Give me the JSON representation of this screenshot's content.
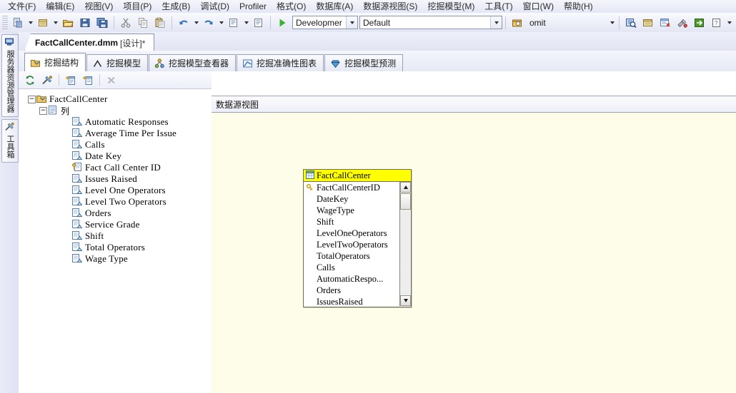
{
  "menu": {
    "items": [
      {
        "label": "文件(F)"
      },
      {
        "label": "编辑(E)"
      },
      {
        "label": "视图(V)"
      },
      {
        "label": "项目(P)"
      },
      {
        "label": "生成(B)"
      },
      {
        "label": "调试(D)"
      },
      {
        "label": "Profiler"
      },
      {
        "label": "格式(O)"
      },
      {
        "label": "数据库(A)"
      },
      {
        "label": "数据源视图(S)"
      },
      {
        "label": "挖掘模型(M)"
      },
      {
        "label": "工具(T)"
      },
      {
        "label": "窗口(W)"
      },
      {
        "label": "帮助(H)"
      }
    ]
  },
  "toolbar": {
    "icons": [
      {
        "name": "new-project-icon"
      },
      {
        "name": "new-item-icon"
      },
      {
        "name": "open-folder-icon"
      },
      {
        "name": "save-icon"
      },
      {
        "name": "save-all-icon"
      },
      {
        "name": "cut-icon"
      },
      {
        "name": "copy-icon"
      },
      {
        "name": "paste-icon"
      },
      {
        "name": "undo-icon"
      },
      {
        "name": "redo-icon"
      },
      {
        "name": "comment-icon"
      },
      {
        "name": "uncomment-icon"
      },
      {
        "name": "start-debug-icon"
      }
    ],
    "configuration": {
      "value": "Developmer",
      "placeholder": "Developmer"
    },
    "platform": {
      "value": "Default",
      "placeholder": "Default"
    },
    "deploy_label": "omit",
    "right_icons": [
      {
        "name": "find-in-files-icon"
      },
      {
        "name": "properties-window-icon"
      },
      {
        "name": "solution-explorer-icon"
      },
      {
        "name": "tools-options-icon"
      },
      {
        "name": "deploy-icon"
      },
      {
        "name": "new-query-icon"
      }
    ]
  },
  "vdock": {
    "tabs": [
      {
        "label": "服务器资源管理器",
        "icon": "server-explorer-icon"
      },
      {
        "label": "工具箱",
        "icon": "toolbox-icon"
      }
    ]
  },
  "doc_tab": {
    "name": "FactCallCenter.dmm",
    "state": "[设计]*"
  },
  "inner_tabs": [
    {
      "label": "挖掘结构",
      "icon": "mining-structure-icon",
      "active": true
    },
    {
      "label": "挖掘模型",
      "icon": "mining-model-icon",
      "active": false
    },
    {
      "label": "挖掘模型查看器",
      "icon": "mining-model-viewer-icon",
      "active": false
    },
    {
      "label": "挖掘准确性图表",
      "icon": "mining-accuracy-chart-icon",
      "active": false
    },
    {
      "label": "挖掘模型预测",
      "icon": "mining-model-prediction-icon",
      "active": false
    }
  ],
  "tree_toolbar": [
    {
      "name": "refresh-structure-icon"
    },
    {
      "name": "process-mining-structure-icon"
    },
    {
      "name": "add-column-icon"
    },
    {
      "name": "add-nested-table-icon"
    },
    {
      "name": "delete-icon"
    }
  ],
  "tree": {
    "root": {
      "label": "FactCallCenter",
      "icon": "mining-structure-icon",
      "expanded": true
    },
    "columns_node": {
      "label": "列",
      "icon": "columns-folder-icon",
      "expanded": true
    },
    "columns": [
      {
        "label": "Automatic Responses",
        "icon": "column-icon"
      },
      {
        "label": "Average Time Per Issue",
        "icon": "column-icon"
      },
      {
        "label": "Calls",
        "icon": "column-icon"
      },
      {
        "label": "Date Key",
        "icon": "column-icon"
      },
      {
        "label": "Fact Call Center ID",
        "icon": "key-column-icon"
      },
      {
        "label": "Issues Raised",
        "icon": "column-icon"
      },
      {
        "label": "Level One Operators",
        "icon": "column-icon"
      },
      {
        "label": "Level Two Operators",
        "icon": "column-icon"
      },
      {
        "label": "Orders",
        "icon": "column-icon"
      },
      {
        "label": "Service Grade",
        "icon": "column-icon"
      },
      {
        "label": "Shift",
        "icon": "column-icon"
      },
      {
        "label": "Total Operators",
        "icon": "column-icon"
      },
      {
        "label": "Wage Type",
        "icon": "column-icon"
      }
    ]
  },
  "dsv": {
    "header_label": "数据源视图",
    "table": {
      "title": "FactCallCenter",
      "title_icon": "table-icon",
      "columns": [
        {
          "label": "FactCallCenterID",
          "icon": "key-icon"
        },
        {
          "label": "DateKey",
          "icon": ""
        },
        {
          "label": "WageType",
          "icon": ""
        },
        {
          "label": "Shift",
          "icon": ""
        },
        {
          "label": "LevelOneOperators",
          "icon": ""
        },
        {
          "label": "LevelTwoOperators",
          "icon": ""
        },
        {
          "label": "TotalOperators",
          "icon": ""
        },
        {
          "label": "Calls",
          "icon": ""
        },
        {
          "label": "AutomaticRespo...",
          "icon": ""
        },
        {
          "label": "Orders",
          "icon": ""
        },
        {
          "label": "IssuesRaised",
          "icon": ""
        }
      ],
      "scrollbar": {
        "up": "▲",
        "down": "▼"
      }
    }
  },
  "colors": {
    "canvas_bg": "#fdfde9",
    "table_header": "#ffff00",
    "chrome": "#eef0fa"
  }
}
